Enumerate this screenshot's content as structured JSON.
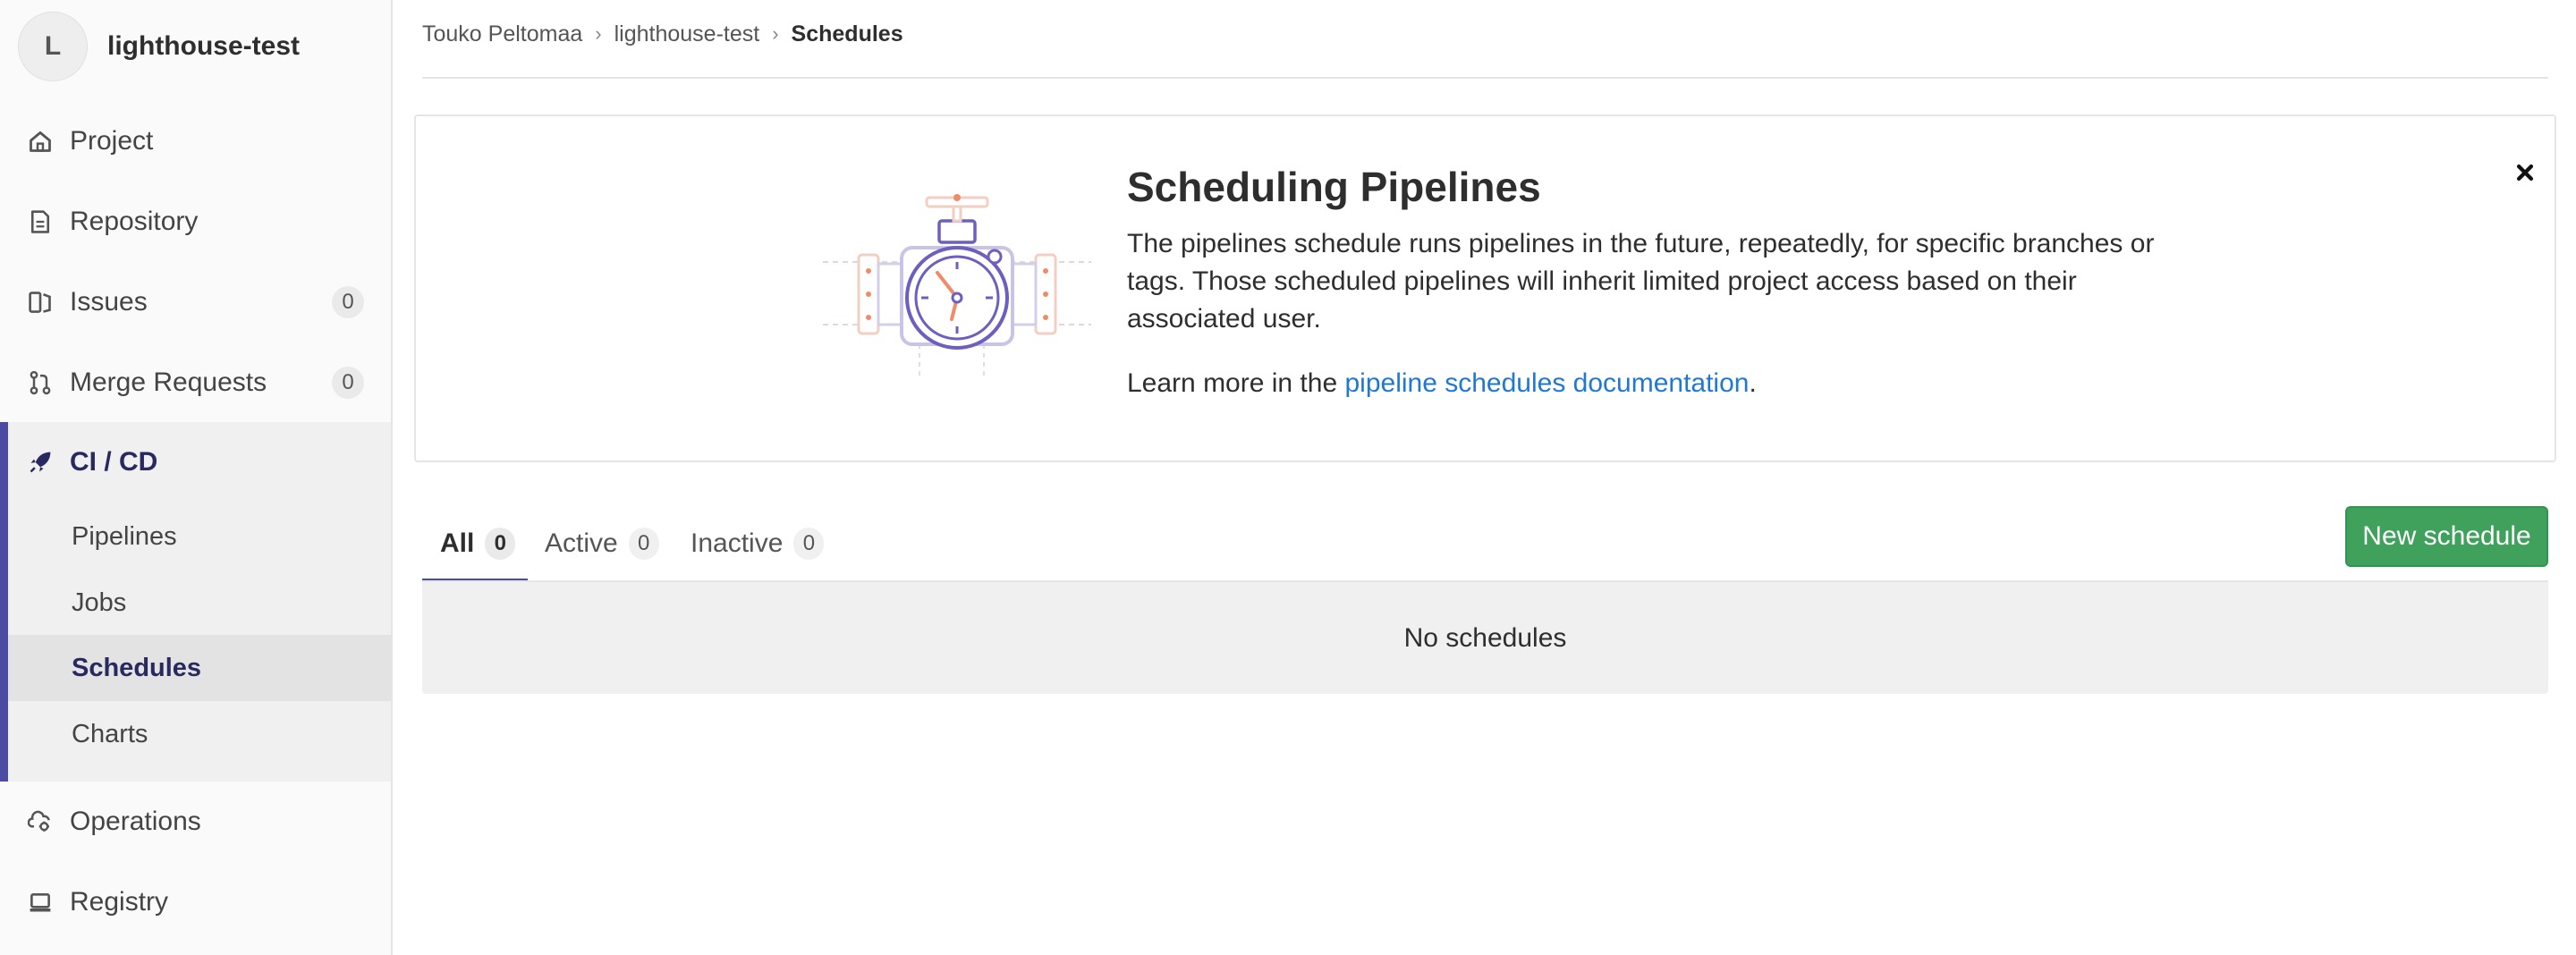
{
  "sidebar": {
    "avatar_letter": "L",
    "project_name": "lighthouse-test",
    "items": [
      {
        "label": "Project",
        "icon": "home-icon"
      },
      {
        "label": "Repository",
        "icon": "document-icon"
      },
      {
        "label": "Issues",
        "icon": "issues-icon",
        "count": "0"
      },
      {
        "label": "Merge Requests",
        "icon": "merge-request-icon",
        "count": "0"
      },
      {
        "label": "CI / CD",
        "icon": "rocket-icon"
      },
      {
        "label": "Operations",
        "icon": "cloud-gear-icon"
      },
      {
        "label": "Registry",
        "icon": "container-icon"
      }
    ],
    "cicd_sub": [
      {
        "label": "Pipelines"
      },
      {
        "label": "Jobs"
      },
      {
        "label": "Schedules"
      },
      {
        "label": "Charts"
      }
    ],
    "active_color": "#292961",
    "accent_bar_color": "#4b4ba3"
  },
  "breadcrumb": {
    "items": [
      "Touko Peltomaa",
      "lighthouse-test"
    ],
    "current": "Schedules"
  },
  "callout": {
    "title": "Scheduling Pipelines",
    "body": "The pipelines schedule runs pipelines in the future, repeatedly, for specific branches or tags. Those scheduled pipelines will inherit limited project access based on their associated user.",
    "learn_prefix": "Learn more in the ",
    "learn_link": "pipeline schedules documentation",
    "learn_suffix": ".",
    "illustration": "pipeline-schedule-stopwatch-illustration",
    "close_icon": "close-icon"
  },
  "tabs": [
    {
      "label": "All",
      "count": "0",
      "active": true
    },
    {
      "label": "Active",
      "count": "0",
      "active": false
    },
    {
      "label": "Inactive",
      "count": "0",
      "active": false
    }
  ],
  "new_schedule_label": "New schedule",
  "new_schedule_color": "#3fa15b",
  "empty_message": "No schedules",
  "link_color": "#1f78d1"
}
